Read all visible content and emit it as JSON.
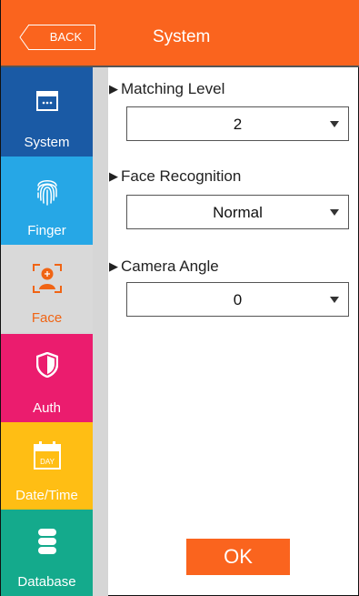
{
  "header": {
    "back_label": "BACK",
    "title": "System"
  },
  "sidebar": {
    "items": [
      {
        "label": "System",
        "icon": "window-dots-icon",
        "color": "#1a5aa5",
        "active": false
      },
      {
        "label": "Finger",
        "icon": "fingerprint-icon",
        "color": "#26a7e6",
        "active": false
      },
      {
        "label": "Face",
        "icon": "face-frame-icon",
        "color": "#d9d9d9",
        "active": true
      },
      {
        "label": "Auth",
        "icon": "shield-icon",
        "color": "#eb1c6e",
        "active": false
      },
      {
        "label": "Date/Time",
        "icon": "calendar-day-icon",
        "color": "#ffbe14",
        "active": false
      },
      {
        "label": "Database",
        "icon": "database-icon",
        "color": "#14aa8c",
        "active": false
      }
    ],
    "calendar_text": "DAY"
  },
  "settings": {
    "matching_level": {
      "label": "Matching Level",
      "value": "2"
    },
    "face_recognition": {
      "label": "Face Recognition",
      "value": "Normal"
    },
    "camera_angle": {
      "label": "Camera Angle",
      "value": "0"
    }
  },
  "actions": {
    "ok_label": "OK"
  },
  "colors": {
    "accent": "#fa641e",
    "active_item_text": "#f06414"
  }
}
